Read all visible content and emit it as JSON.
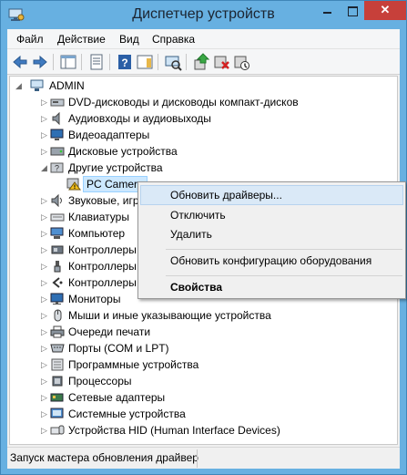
{
  "window": {
    "title": "Диспетчер устройств",
    "close_glyph": "✕"
  },
  "menubar": {
    "items": [
      "Файл",
      "Действие",
      "Вид",
      "Справка"
    ]
  },
  "toolbar": {
    "buttons": [
      "back-icon",
      "forward-icon",
      "show-hide-console-tree-icon",
      "properties-icon",
      "help-icon",
      "action-pane-icon",
      "scan-hardware-icon",
      "update-driver-icon",
      "uninstall-icon",
      "disable-icon"
    ]
  },
  "tree": {
    "root": "ADMIN",
    "items": [
      {
        "label": "DVD-дисководы и дисководы компакт-дисков",
        "icon": "dvd-drive-icon",
        "state": "collapsed"
      },
      {
        "label": "Аудиовходы и аудиовыходы",
        "icon": "audio-icon",
        "state": "collapsed"
      },
      {
        "label": "Видеоадаптеры",
        "icon": "display-adapter-icon",
        "state": "collapsed"
      },
      {
        "label": "Дисковые устройства",
        "icon": "disk-drive-icon",
        "state": "collapsed"
      },
      {
        "label": "Другие устройства",
        "icon": "other-devices-icon",
        "state": "expanded"
      },
      {
        "label": "PC Camera",
        "icon": "unknown-device-warning-icon",
        "state": "child-selected"
      },
      {
        "label": "Звуковые, игр",
        "icon": "sound-icon",
        "state": "collapsed"
      },
      {
        "label": "Клавиатуры",
        "icon": "keyboard-icon",
        "state": "collapsed"
      },
      {
        "label": "Компьютер",
        "icon": "computer-icon",
        "state": "collapsed"
      },
      {
        "label": "Контроллеры",
        "icon": "controller-icon",
        "state": "collapsed"
      },
      {
        "label": "Контроллеры",
        "icon": "usb-controller-icon",
        "state": "collapsed"
      },
      {
        "label": "Контроллеры",
        "icon": "storage-controller-icon",
        "state": "collapsed"
      },
      {
        "label": "Мониторы",
        "icon": "monitor-icon",
        "state": "collapsed"
      },
      {
        "label": "Мыши и иные указывающие устройства",
        "icon": "mouse-icon",
        "state": "collapsed"
      },
      {
        "label": "Очереди печати",
        "icon": "print-queue-icon",
        "state": "collapsed"
      },
      {
        "label": "Порты (COM и LPT)",
        "icon": "port-icon",
        "state": "collapsed"
      },
      {
        "label": "Программные устройства",
        "icon": "software-device-icon",
        "state": "collapsed"
      },
      {
        "label": "Процессоры",
        "icon": "processor-icon",
        "state": "collapsed"
      },
      {
        "label": "Сетевые адаптеры",
        "icon": "network-adapter-icon",
        "state": "collapsed"
      },
      {
        "label": "Системные устройства",
        "icon": "system-device-icon",
        "state": "collapsed"
      },
      {
        "label": "Устройства HID (Human Interface Devices)",
        "icon": "hid-icon",
        "state": "collapsed"
      }
    ]
  },
  "context_menu": {
    "update_drivers": "Обновить драйверы...",
    "disable": "Отключить",
    "uninstall": "Удалить",
    "scan_hardware": "Обновить конфигурацию оборудования",
    "properties": "Свойства"
  },
  "statusbar": {
    "text": "Запуск мастера обновления драйвер"
  },
  "colors": {
    "titlebar": "#67b0e1",
    "close": "#c7403a",
    "selection": "#cce8ff",
    "menu_highlight": "#dae9f7"
  }
}
